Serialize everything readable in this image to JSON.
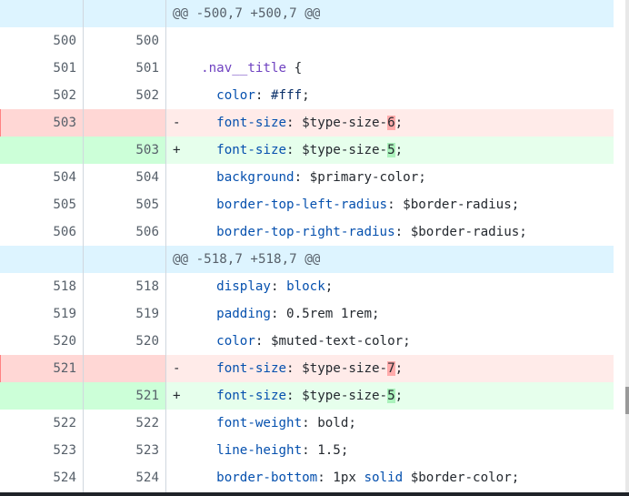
{
  "rows": [
    {
      "type": "hunk",
      "text": "@@ -500,7 +500,7 @@"
    },
    {
      "type": "ctx",
      "old": "500",
      "new": "500",
      "marker": "",
      "tokens": []
    },
    {
      "type": "ctx",
      "old": "501",
      "new": "501",
      "marker": "",
      "tokens": [
        {
          "t": "  "
        },
        {
          "t": ".nav__title",
          "c": "k"
        },
        {
          "t": " {"
        }
      ]
    },
    {
      "type": "ctx",
      "old": "502",
      "new": "502",
      "marker": "",
      "tokens": [
        {
          "t": "    "
        },
        {
          "t": "color",
          "c": "p"
        },
        {
          "t": ": "
        },
        {
          "t": "#fff",
          "c": "v"
        },
        {
          "t": ";"
        }
      ]
    },
    {
      "type": "del",
      "old": "503",
      "new": "",
      "marker": "-",
      "tokens": [
        {
          "t": "    "
        },
        {
          "t": "font-size",
          "c": "p"
        },
        {
          "t": ": $type-size-"
        },
        {
          "t": "6",
          "c": "rm-hl"
        },
        {
          "t": ";"
        }
      ]
    },
    {
      "type": "add",
      "old": "",
      "new": "503",
      "marker": "+",
      "tokens": [
        {
          "t": "    "
        },
        {
          "t": "font-size",
          "c": "p"
        },
        {
          "t": ": $type-size-"
        },
        {
          "t": "5",
          "c": "ad-hl"
        },
        {
          "t": ";"
        }
      ]
    },
    {
      "type": "ctx",
      "old": "504",
      "new": "504",
      "marker": "",
      "tokens": [
        {
          "t": "    "
        },
        {
          "t": "background",
          "c": "p"
        },
        {
          "t": ": $primary-color;"
        }
      ]
    },
    {
      "type": "ctx",
      "old": "505",
      "new": "505",
      "marker": "",
      "tokens": [
        {
          "t": "    "
        },
        {
          "t": "border-top-left-radius",
          "c": "p"
        },
        {
          "t": ": $border-radius;"
        }
      ]
    },
    {
      "type": "ctx",
      "old": "506",
      "new": "506",
      "marker": "",
      "tokens": [
        {
          "t": "    "
        },
        {
          "t": "border-top-right-radius",
          "c": "p"
        },
        {
          "t": ": $border-radius;"
        }
      ]
    },
    {
      "type": "hunk",
      "text": "@@ -518,7 +518,7 @@"
    },
    {
      "type": "ctx",
      "old": "518",
      "new": "518",
      "marker": "",
      "tokens": [
        {
          "t": "    "
        },
        {
          "t": "display",
          "c": "p"
        },
        {
          "t": ": "
        },
        {
          "t": "block",
          "c": "kw"
        },
        {
          "t": ";"
        }
      ]
    },
    {
      "type": "ctx",
      "old": "519",
      "new": "519",
      "marker": "",
      "tokens": [
        {
          "t": "    "
        },
        {
          "t": "padding",
          "c": "p"
        },
        {
          "t": ": 0.5rem 1rem;"
        }
      ]
    },
    {
      "type": "ctx",
      "old": "520",
      "new": "520",
      "marker": "",
      "tokens": [
        {
          "t": "    "
        },
        {
          "t": "color",
          "c": "p"
        },
        {
          "t": ": $muted-text-color;"
        }
      ]
    },
    {
      "type": "del",
      "old": "521",
      "new": "",
      "marker": "-",
      "tokens": [
        {
          "t": "    "
        },
        {
          "t": "font-size",
          "c": "p"
        },
        {
          "t": ": $type-size-"
        },
        {
          "t": "7",
          "c": "rm-hl"
        },
        {
          "t": ";"
        }
      ]
    },
    {
      "type": "add",
      "old": "",
      "new": "521",
      "marker": "+",
      "tokens": [
        {
          "t": "    "
        },
        {
          "t": "font-size",
          "c": "p"
        },
        {
          "t": ": $type-size-"
        },
        {
          "t": "5",
          "c": "ad-hl"
        },
        {
          "t": ";"
        }
      ]
    },
    {
      "type": "ctx",
      "old": "522",
      "new": "522",
      "marker": "",
      "tokens": [
        {
          "t": "    "
        },
        {
          "t": "font-weight",
          "c": "p"
        },
        {
          "t": ": bold;"
        }
      ]
    },
    {
      "type": "ctx",
      "old": "523",
      "new": "523",
      "marker": "",
      "tokens": [
        {
          "t": "    "
        },
        {
          "t": "line-height",
          "c": "p"
        },
        {
          "t": ": 1.5;"
        }
      ]
    },
    {
      "type": "ctx",
      "old": "524",
      "new": "524",
      "marker": "",
      "tokens": [
        {
          "t": "    "
        },
        {
          "t": "border-bottom",
          "c": "p"
        },
        {
          "t": ": 1px "
        },
        {
          "t": "solid",
          "c": "kw"
        },
        {
          "t": " $border-color;"
        }
      ]
    }
  ],
  "colors": {
    "hunk_bg": "#ddf4ff",
    "del_bg": "#ffebe9",
    "add_bg": "#e6ffec",
    "del_highlight": "#ffabab",
    "add_highlight": "#abf2bc"
  }
}
